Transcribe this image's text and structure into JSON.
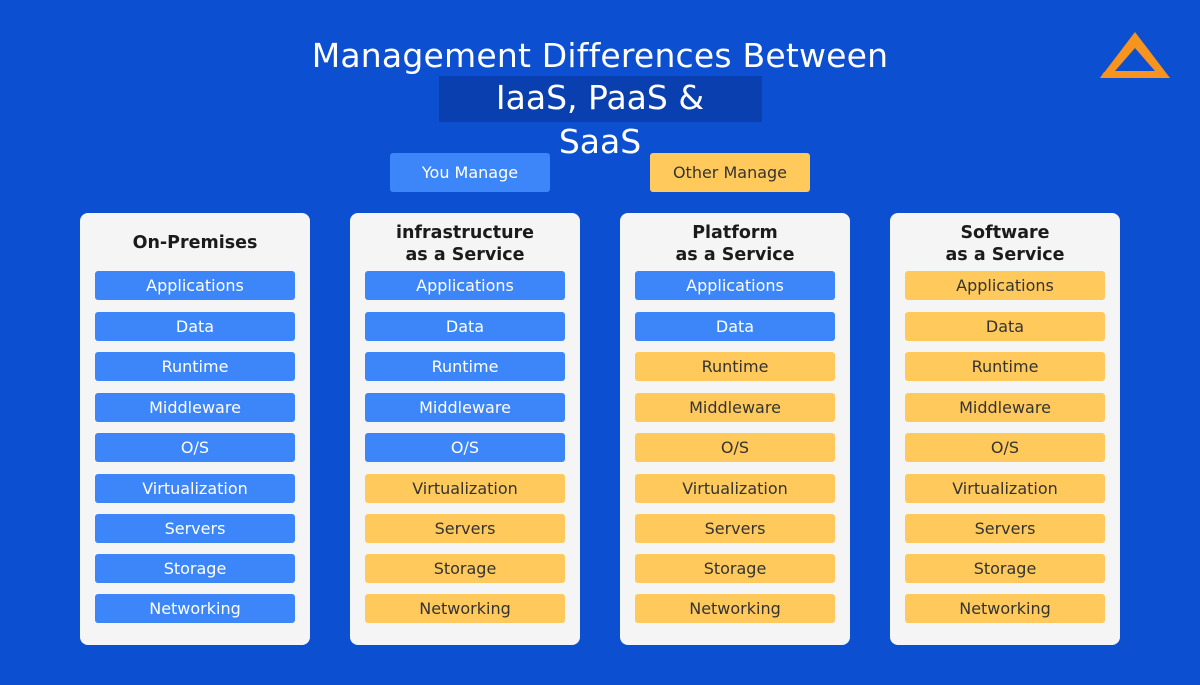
{
  "header": {
    "title": "Management Differences Between",
    "subtitle": "IaaS, PaaS & SaaS"
  },
  "logo": {
    "icon": "triangle-logo-icon",
    "color": "#f7941d"
  },
  "legend": {
    "you_manage": {
      "label": "You Manage",
      "color": "#3d86f9"
    },
    "other_manage": {
      "label": "Other Manage",
      "color": "#ffc95c"
    }
  },
  "columns": [
    {
      "title_line1": "On-Premises",
      "title_line2": "",
      "rows": [
        {
          "label": "Applications",
          "managed_by": "you"
        },
        {
          "label": "Data",
          "managed_by": "you"
        },
        {
          "label": "Runtime",
          "managed_by": "you"
        },
        {
          "label": "Middleware",
          "managed_by": "you"
        },
        {
          "label": "O/S",
          "managed_by": "you"
        },
        {
          "label": "Virtualization",
          "managed_by": "you"
        },
        {
          "label": "Servers",
          "managed_by": "you"
        },
        {
          "label": "Storage",
          "managed_by": "you"
        },
        {
          "label": "Networking",
          "managed_by": "you"
        }
      ]
    },
    {
      "title_line1": "infrastructure",
      "title_line2": "as a Service",
      "rows": [
        {
          "label": "Applications",
          "managed_by": "you"
        },
        {
          "label": "Data",
          "managed_by": "you"
        },
        {
          "label": "Runtime",
          "managed_by": "you"
        },
        {
          "label": "Middleware",
          "managed_by": "you"
        },
        {
          "label": "O/S",
          "managed_by": "you"
        },
        {
          "label": "Virtualization",
          "managed_by": "other"
        },
        {
          "label": "Servers",
          "managed_by": "other"
        },
        {
          "label": "Storage",
          "managed_by": "other"
        },
        {
          "label": "Networking",
          "managed_by": "other"
        }
      ]
    },
    {
      "title_line1": "Platform",
      "title_line2": "as a Service",
      "rows": [
        {
          "label": "Applications",
          "managed_by": "you"
        },
        {
          "label": "Data",
          "managed_by": "you"
        },
        {
          "label": "Runtime",
          "managed_by": "other"
        },
        {
          "label": "Middleware",
          "managed_by": "other"
        },
        {
          "label": "O/S",
          "managed_by": "other"
        },
        {
          "label": "Virtualization",
          "managed_by": "other"
        },
        {
          "label": "Servers",
          "managed_by": "other"
        },
        {
          "label": "Storage",
          "managed_by": "other"
        },
        {
          "label": "Networking",
          "managed_by": "other"
        }
      ]
    },
    {
      "title_line1": "Software",
      "title_line2": "as a Service",
      "rows": [
        {
          "label": "Applications",
          "managed_by": "other"
        },
        {
          "label": "Data",
          "managed_by": "other"
        },
        {
          "label": "Runtime",
          "managed_by": "other"
        },
        {
          "label": "Middleware",
          "managed_by": "other"
        },
        {
          "label": "O/S",
          "managed_by": "other"
        },
        {
          "label": "Virtualization",
          "managed_by": "other"
        },
        {
          "label": "Servers",
          "managed_by": "other"
        },
        {
          "label": "Storage",
          "managed_by": "other"
        },
        {
          "label": "Networking",
          "managed_by": "other"
        }
      ]
    }
  ]
}
